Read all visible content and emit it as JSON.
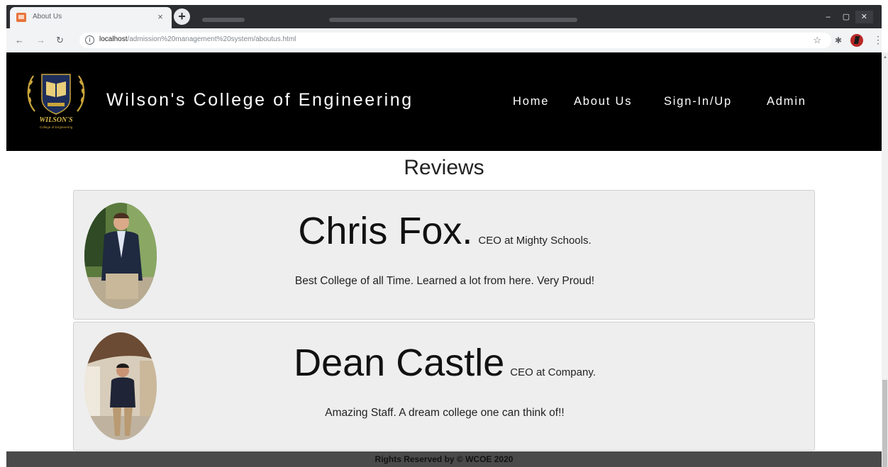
{
  "browser": {
    "tab_title": "About Us",
    "tab_close": "×",
    "new_tab": "+",
    "url_host": "localhost",
    "url_path": "/admission%20management%20system/aboutus.html",
    "window_controls": [
      "–",
      "▢",
      "✕"
    ]
  },
  "header": {
    "brand": "Wilson's College of Engineering",
    "logo_text": "WILSON'S",
    "logo_sub": "College of Engineering",
    "nav": [
      "Home",
      "About Us",
      "Sign-In/Up",
      "Admin"
    ]
  },
  "reviews": {
    "title": "Reviews",
    "items": [
      {
        "name": "Chris Fox.",
        "role": "CEO at Mighty Schools.",
        "quote": "Best College of all Time. Learned a lot from here. Very Proud!"
      },
      {
        "name": "Dean Castle",
        "role": "CEO at Company.",
        "quote": "Amazing Staff. A dream college one can think of!!"
      }
    ]
  },
  "footer": {
    "text": "Rights Reserved by © WCOE 2020"
  },
  "colors": {
    "header_bg": "#000000",
    "card_bg": "#eeeeee",
    "footer_bg": "#4a4a4a",
    "logo_gold": "#c9a53a",
    "logo_navy": "#1d2e5c"
  },
  "icons": [
    "back-arrow-icon",
    "forward-arrow-icon",
    "reload-icon",
    "info-icon",
    "star-icon",
    "extensions-icon",
    "profile-icon",
    "menu-icon"
  ]
}
